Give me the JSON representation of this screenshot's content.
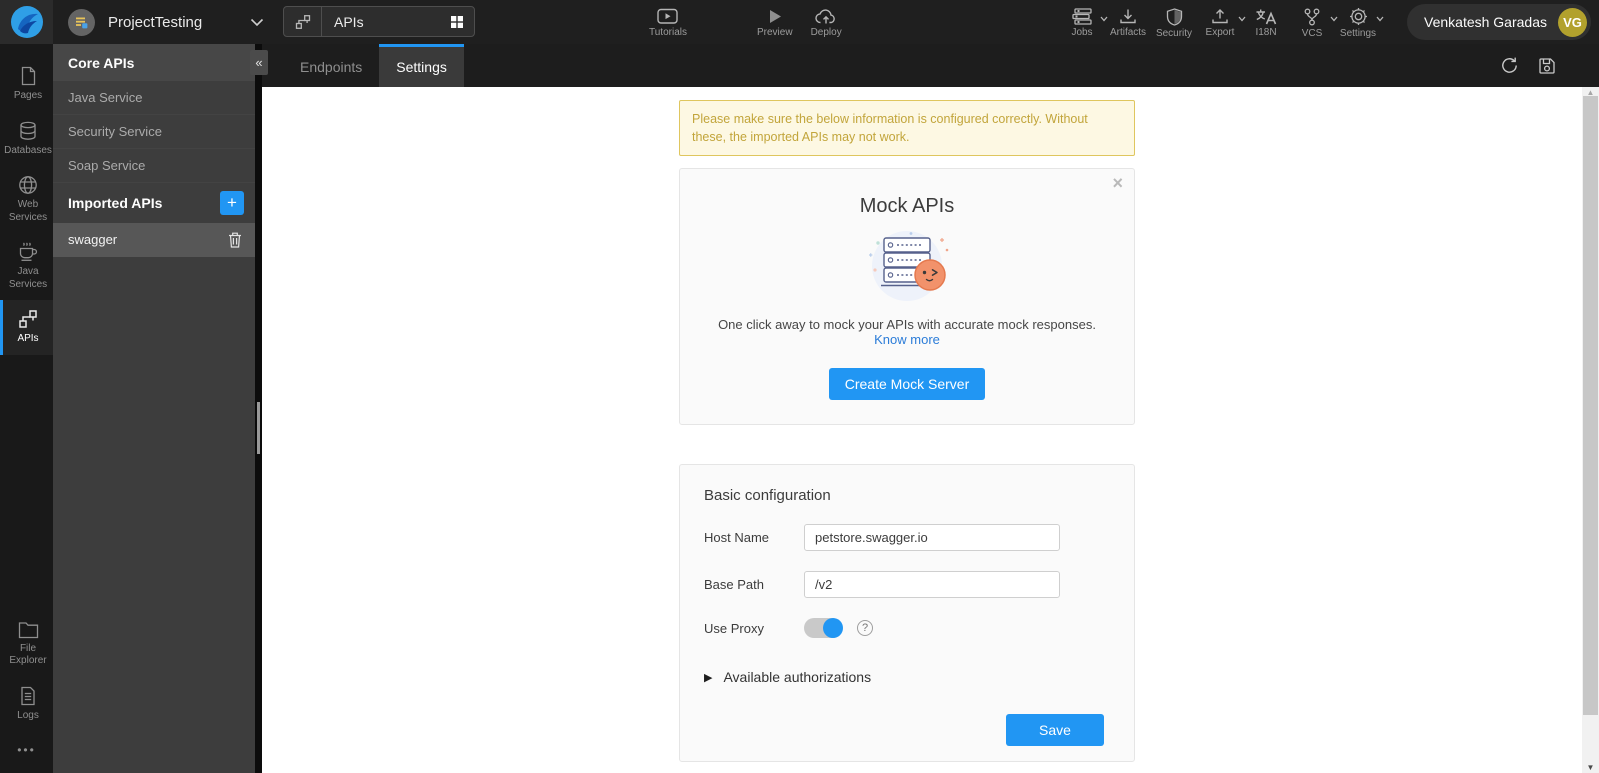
{
  "topbar": {
    "project_name": "ProjectTesting",
    "selector_label": "APIs",
    "center_items": [
      {
        "label": "Tutorials"
      },
      {
        "label": "Preview"
      },
      {
        "label": "Deploy"
      }
    ],
    "right_items": [
      {
        "label": "Jobs",
        "caret": true
      },
      {
        "label": "Artifacts",
        "caret": false
      },
      {
        "label": "Security",
        "caret": false
      },
      {
        "label": "Export",
        "caret": true
      },
      {
        "label": "I18N",
        "caret": false
      },
      {
        "label": "VCS",
        "caret": true
      },
      {
        "label": "Settings",
        "caret": true
      }
    ],
    "user": {
      "name": "Venkatesh Garadas",
      "initials": "VG"
    }
  },
  "sidebar": {
    "items": [
      {
        "label": "Pages"
      },
      {
        "label": "Databases"
      },
      {
        "label": "Web Services"
      },
      {
        "label": "Java Services"
      },
      {
        "label": "APIs",
        "active": true
      }
    ],
    "bottom_items": [
      {
        "label": "File Explorer"
      },
      {
        "label": "Logs"
      }
    ]
  },
  "panel": {
    "title": "Core APIs",
    "items": [
      {
        "label": "Java Service"
      },
      {
        "label": "Security Service"
      },
      {
        "label": "Soap Service"
      }
    ],
    "imported_title": "Imported APIs",
    "imported_items": [
      {
        "label": "swagger",
        "selected": true
      }
    ]
  },
  "tabs": [
    {
      "label": "Endpoints",
      "active": false
    },
    {
      "label": "Settings",
      "active": true
    }
  ],
  "content": {
    "warning": "Please make sure the below information is configured correctly. Without these, the imported APIs may not work.",
    "mock": {
      "title": "Mock APIs",
      "description": "One click away to mock your APIs with accurate mock responses.",
      "link_label": "Know more",
      "button_label": "Create Mock Server"
    },
    "config": {
      "title": "Basic configuration",
      "host_label": "Host Name",
      "host_value": "petstore.swagger.io",
      "base_label": "Base Path",
      "base_value": "/v2",
      "proxy_label": "Use Proxy",
      "proxy_enabled": "true",
      "auth_label": "Available authorizations",
      "save_label": "Save"
    }
  },
  "icons": {
    "collapse": "«",
    "add": "+",
    "close": "×",
    "help": "?",
    "expand": "▶",
    "scroll_up": "▲",
    "scroll_down": "▼",
    "more": "•••"
  },
  "colors": {
    "accent_blue": "#2196f3",
    "warning_text": "#c2a53b",
    "warning_bg": "#fdf8e3",
    "avatar_gold": "#b2a12d",
    "illustration_orange": "#f2926b"
  }
}
